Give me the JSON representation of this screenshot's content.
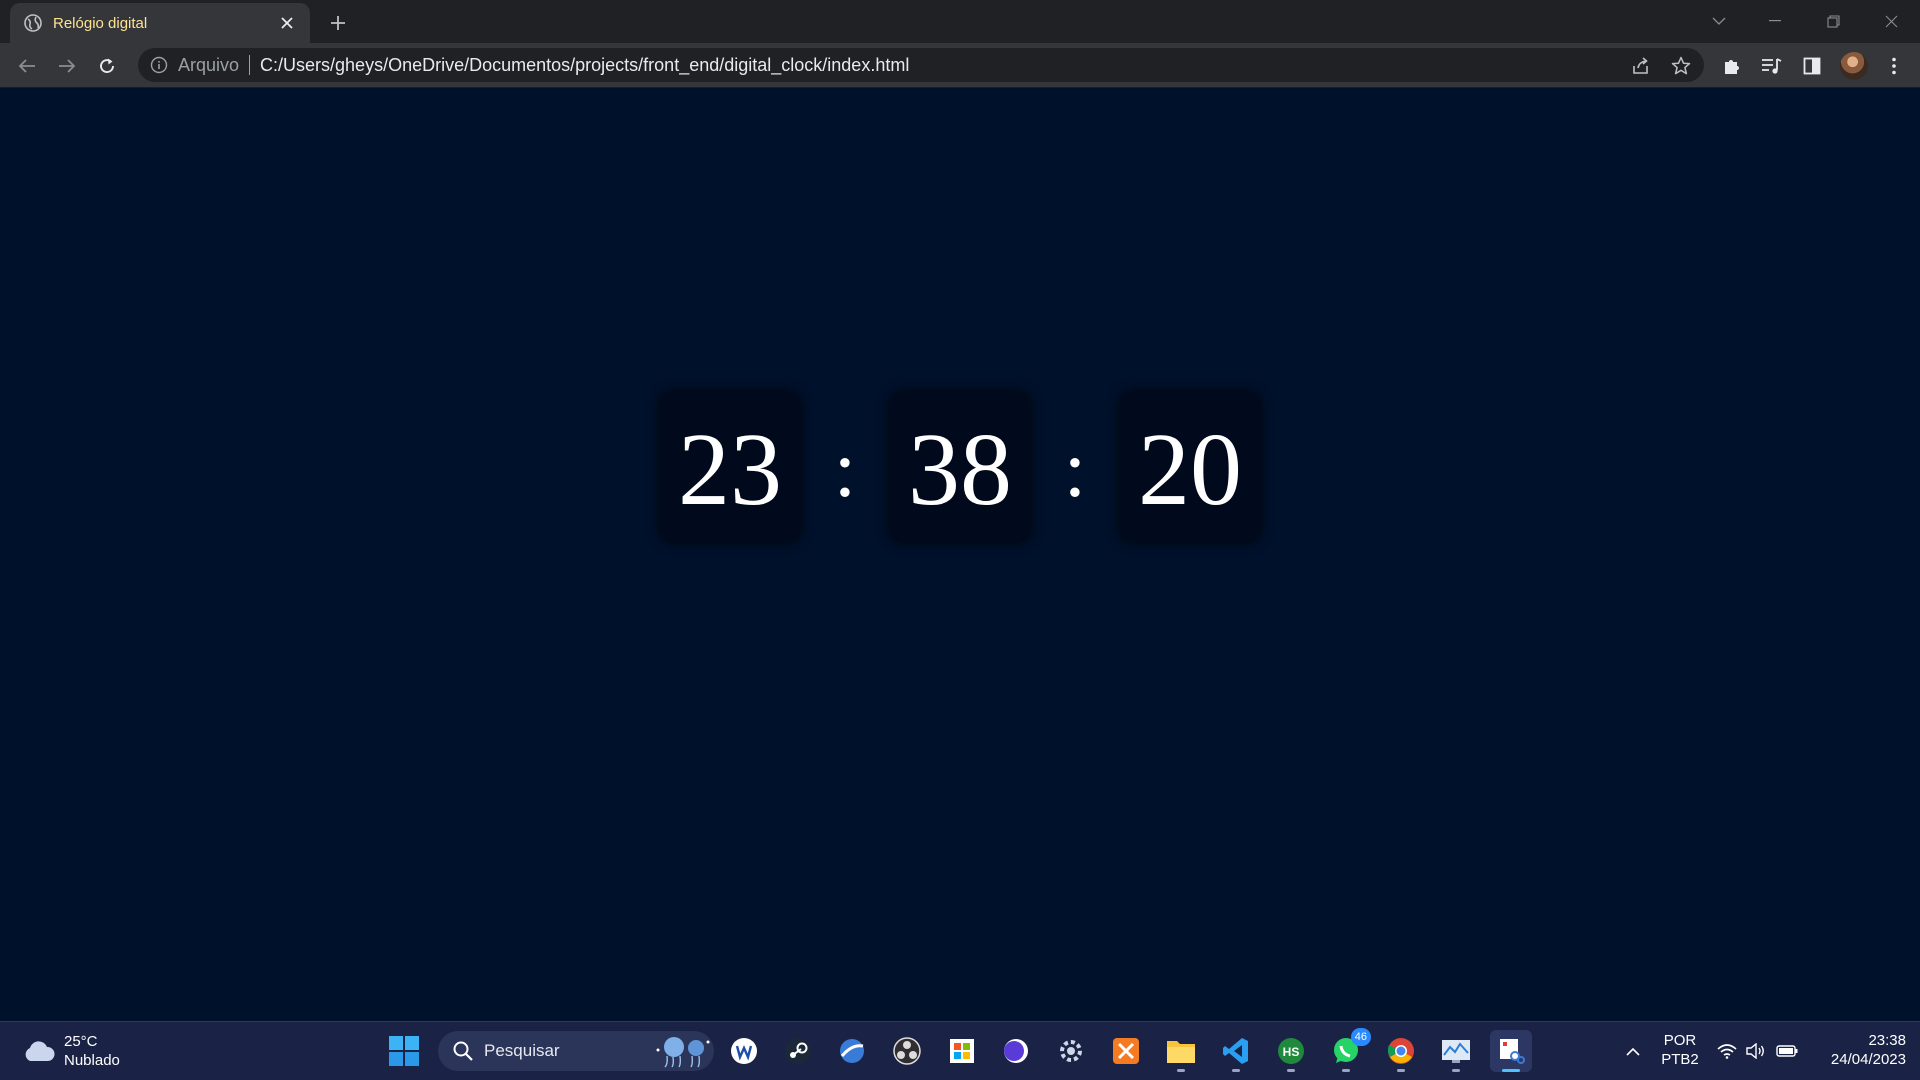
{
  "browser": {
    "tab_title": "Relógio digital",
    "address_scheme": "Arquivo",
    "address_url": "C:/Users/gheys/OneDrive/Documentos/projects/front_end/digital_clock/index.html"
  },
  "clock": {
    "hours": "23",
    "minutes": "38",
    "seconds": "20",
    "separator": ":"
  },
  "taskbar": {
    "weather_temp": "25°C",
    "weather_desc": "Nublado",
    "search_placeholder": "Pesquisar",
    "whatsapp_badge": "46",
    "lang_line1": "POR",
    "lang_line2": "PTB2",
    "time": "23:38",
    "date": "24/04/2023"
  },
  "icons": [
    "globe-icon",
    "close-icon",
    "plus-icon",
    "chevron-down-icon",
    "minimize-icon",
    "restore-icon",
    "back-arrow-icon",
    "forward-arrow-icon",
    "reload-icon",
    "info-icon",
    "share-icon",
    "star-icon",
    "puzzle-icon",
    "media-icon",
    "side-panel-icon",
    "kebab-menu-icon",
    "cloud-icon",
    "windows-logo-icon",
    "search-icon",
    "tray-chevron-icon",
    "wifi-icon",
    "volume-icon",
    "battery-icon"
  ],
  "colors": {
    "page_background": "#00112c",
    "digit_box": "#000a1c",
    "digit_text": "#ffffff",
    "tab_title": "#fde293",
    "taskbar": "#1a2346",
    "accent": "#4cc2ff"
  }
}
